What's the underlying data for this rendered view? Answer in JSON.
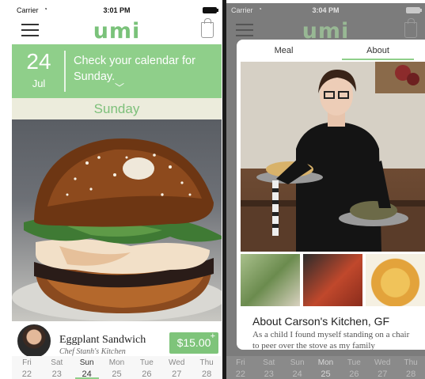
{
  "left": {
    "status": {
      "carrier": "Carrier",
      "time": "3:01 PM"
    },
    "logo": "umi",
    "date": {
      "day": "24",
      "month": "Jul",
      "message": "Check your calendar for Sunday."
    },
    "day_label": "Sunday",
    "item": {
      "name": "Eggplant Sandwich",
      "chef": "Chef Stanh's Kitchen",
      "price": "$15.00"
    },
    "week": [
      {
        "dow": "Fri",
        "num": "22"
      },
      {
        "dow": "Sat",
        "num": "23"
      },
      {
        "dow": "Sun",
        "num": "24"
      },
      {
        "dow": "Mon",
        "num": "25"
      },
      {
        "dow": "Tue",
        "num": "26"
      },
      {
        "dow": "Wed",
        "num": "27"
      },
      {
        "dow": "Thu",
        "num": "28"
      }
    ]
  },
  "right": {
    "status": {
      "carrier": "Carrier",
      "time": "3:04 PM"
    },
    "logo": "umi",
    "tabs": [
      "Meal",
      "About"
    ],
    "about_title": "About Carson's Kitchen, GF",
    "about_body": "As a child I found myself standing on a chair to peer over the stove as my family",
    "week": [
      {
        "dow": "Fri",
        "num": "22"
      },
      {
        "dow": "Sat",
        "num": "23"
      },
      {
        "dow": "Sun",
        "num": "24"
      },
      {
        "dow": "Mon",
        "num": "25"
      },
      {
        "dow": "Tue",
        "num": "26"
      },
      {
        "dow": "Wed",
        "num": "27"
      },
      {
        "dow": "Thu",
        "num": "28"
      }
    ]
  }
}
